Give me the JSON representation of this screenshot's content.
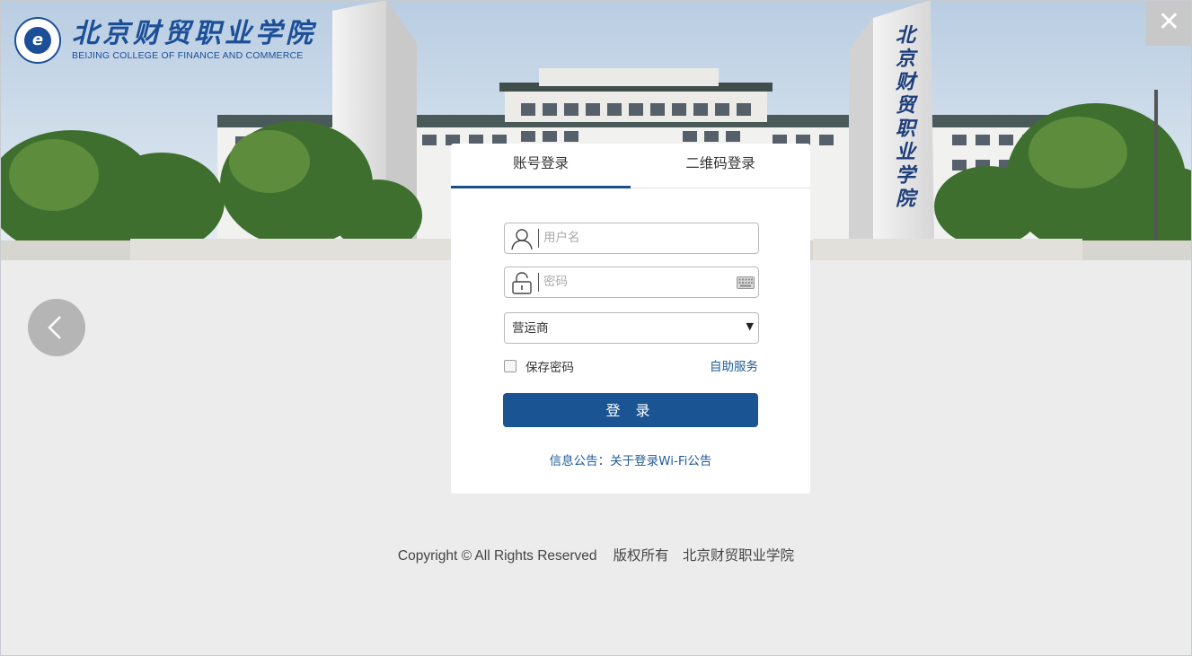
{
  "header": {
    "logo_text": "北京财贸职业学院",
    "logo_sub": "BEIJING COLLEGE OF FINANCE AND COMMERCE",
    "monument_text": "北京财贸职业学院",
    "close_label": "✕"
  },
  "tabs": [
    {
      "label": "账号登录",
      "active": true
    },
    {
      "label": "二维码登录",
      "active": false
    }
  ],
  "form": {
    "username_placeholder": "用户名",
    "password_placeholder": "密码",
    "carrier_value": "营运商",
    "remember_label": "保存密码",
    "self_service": "自助服务",
    "login_button": "登 录"
  },
  "notice": {
    "prefix": "信息公告：",
    "link": "关于登录Wi-Fi公告"
  },
  "footer": {
    "copyright": "Copyright © All Rights Reserved",
    "owner": "版权所有　北京财贸职业学院"
  },
  "colors": {
    "primary": "#1b5493",
    "link": "#1f5c99",
    "page_background": "#ececec",
    "close_background": "#c8c8c8"
  },
  "icons": [
    "close-icon",
    "chevron-left-icon",
    "user-icon",
    "lock-icon",
    "keyboard-icon",
    "caret-down-icon",
    "school-emblem-icon"
  ]
}
